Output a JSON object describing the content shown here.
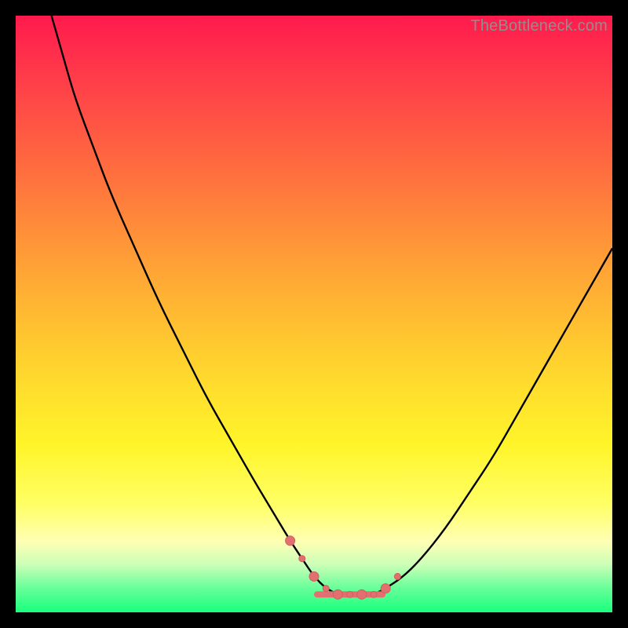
{
  "watermark": "TheBottleneck.com",
  "colors": {
    "frame": "#000000",
    "curve": "#000000",
    "marker_fill": "#e37070",
    "marker_stroke": "#d25e5e",
    "gradient_stops": [
      {
        "offset": 0.0,
        "color": "#ff1a4d"
      },
      {
        "offset": 0.1,
        "color": "#ff3b4a"
      },
      {
        "offset": 0.25,
        "color": "#ff6a3f"
      },
      {
        "offset": 0.42,
        "color": "#ffa236"
      },
      {
        "offset": 0.58,
        "color": "#ffd22e"
      },
      {
        "offset": 0.72,
        "color": "#fff52a"
      },
      {
        "offset": 0.82,
        "color": "#ffff66"
      },
      {
        "offset": 0.88,
        "color": "#ffffb3"
      },
      {
        "offset": 0.92,
        "color": "#ccffb8"
      },
      {
        "offset": 0.96,
        "color": "#66ff99"
      },
      {
        "offset": 1.0,
        "color": "#19ff7d"
      }
    ]
  },
  "chart_data": {
    "type": "line",
    "title": "",
    "xlabel": "",
    "ylabel": "",
    "xlim": [
      0,
      100
    ],
    "ylim": [
      0,
      100
    ],
    "grid": false,
    "legend": false,
    "series": [
      {
        "name": "bottleneck-curve",
        "x": [
          6,
          8,
          10,
          13,
          16,
          20,
          24,
          28,
          32,
          36,
          40,
          43,
          46,
          48,
          50,
          52,
          54,
          56,
          58,
          60,
          62,
          65,
          68,
          72,
          76,
          80,
          84,
          88,
          92,
          96,
          100
        ],
        "y": [
          100,
          93,
          86,
          78,
          70,
          61,
          52,
          44,
          36,
          29,
          22,
          17,
          12,
          9,
          6,
          4,
          3,
          3,
          3,
          3,
          4,
          6,
          9,
          14,
          20,
          26,
          33,
          40,
          47,
          54,
          61
        ]
      }
    ],
    "markers": {
      "name": "curve-points",
      "x": [
        46,
        48,
        50,
        52,
        54,
        56,
        58,
        60,
        62,
        64
      ],
      "y": [
        12,
        9,
        6,
        4,
        3,
        3,
        3,
        3,
        4,
        6
      ],
      "r_alternating": [
        6,
        4
      ]
    },
    "floor_band": {
      "x": [
        50,
        62
      ],
      "y": 3,
      "thickness": 2
    }
  }
}
